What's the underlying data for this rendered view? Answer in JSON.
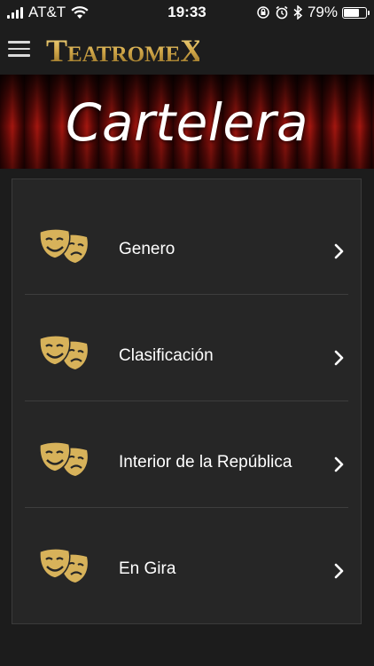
{
  "status_bar": {
    "carrier": "AT&T",
    "time": "19:33",
    "battery": "79%",
    "battery_level": 0.79
  },
  "header": {
    "logo_text": "TEATROMEX",
    "logo_color": "#d7b25a"
  },
  "banner": {
    "title": "Cartelera"
  },
  "menu": {
    "items": [
      {
        "label": "Genero",
        "icon": "theater-masks-icon"
      },
      {
        "label": "Clasificación",
        "icon": "theater-masks-icon"
      },
      {
        "label": "Interior de la República",
        "icon": "theater-masks-icon"
      },
      {
        "label": "En Gira",
        "icon": "theater-masks-icon"
      }
    ]
  },
  "colors": {
    "background": "#1c1c1c",
    "panel": "#262626",
    "accent_gold": "#d7b25a"
  }
}
